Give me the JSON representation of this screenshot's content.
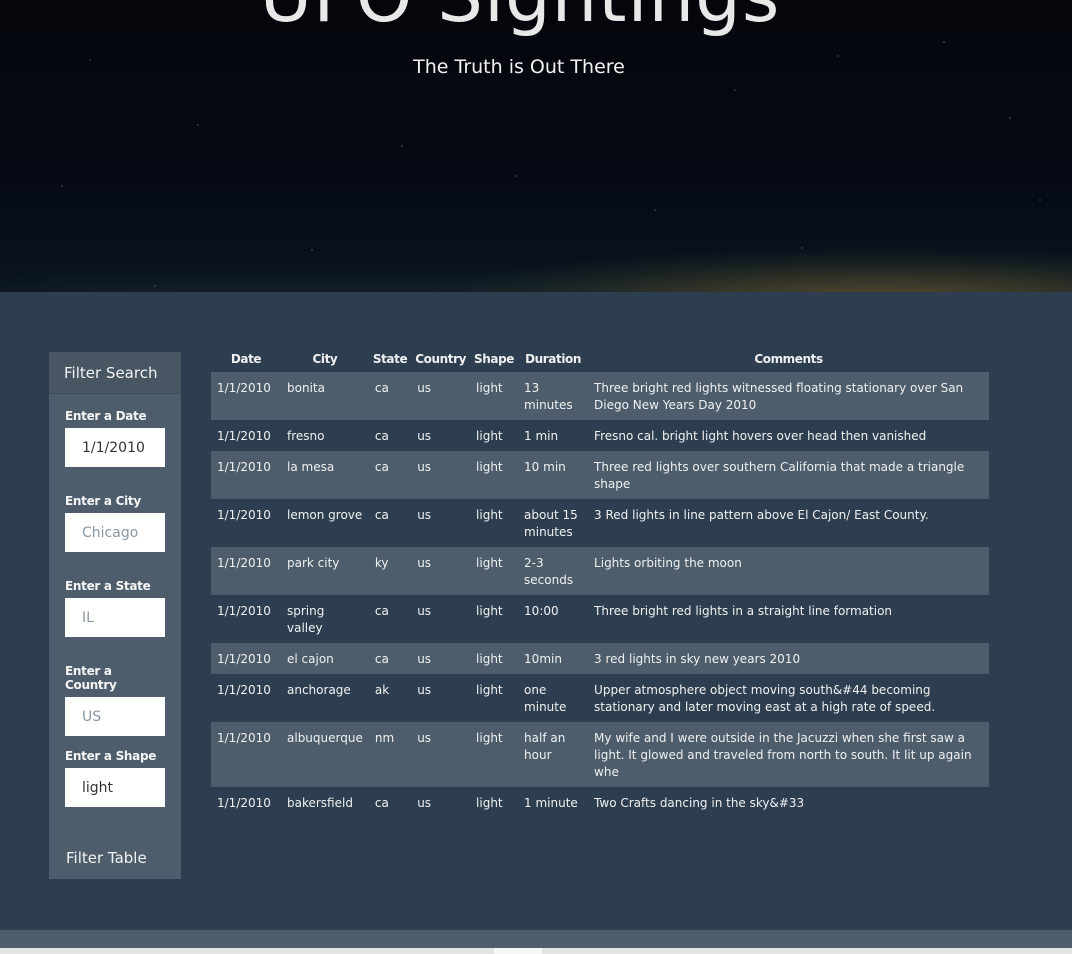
{
  "header": {
    "title": "UFO Sightings",
    "subtitle": "The Truth is Out There"
  },
  "sidebar": {
    "title": "Filter Search",
    "filters": [
      {
        "label": "Enter a Date",
        "value": "1/1/2010",
        "placeholder": ""
      },
      {
        "label": "Enter a City",
        "value": "",
        "placeholder": "Chicago"
      },
      {
        "label": "Enter a State",
        "value": "",
        "placeholder": "IL"
      },
      {
        "label": "Enter a Country",
        "value": "",
        "placeholder": "US"
      },
      {
        "label": "Enter a Shape",
        "value": "light",
        "placeholder": ""
      }
    ],
    "button_label": "Filter Table"
  },
  "table": {
    "columns": [
      "Date",
      "City",
      "State",
      "Country",
      "Shape",
      "Duration",
      "Comments"
    ],
    "rows": [
      [
        "1/1/2010",
        "bonita",
        "ca",
        "us",
        "light",
        "13 minutes",
        "Three bright red lights witnessed floating stationary over San Diego New Years Day 2010"
      ],
      [
        "1/1/2010",
        "fresno",
        "ca",
        "us",
        "light",
        "1 min",
        "Fresno cal. bright light hovers over head then vanished"
      ],
      [
        "1/1/2010",
        "la mesa",
        "ca",
        "us",
        "light",
        "10 min",
        "Three red lights over southern California that made a triangle shape"
      ],
      [
        "1/1/2010",
        "lemon grove",
        "ca",
        "us",
        "light",
        "about 15 minutes",
        "3 Red lights in line pattern above El Cajon/ East County."
      ],
      [
        "1/1/2010",
        "park city",
        "ky",
        "us",
        "light",
        "2-3 seconds",
        "Lights orbiting the moon"
      ],
      [
        "1/1/2010",
        "spring valley",
        "ca",
        "us",
        "light",
        "10:00",
        "Three bright red lights in a straight line formation"
      ],
      [
        "1/1/2010",
        "el cajon",
        "ca",
        "us",
        "light",
        "10min",
        "3 red lights in sky new years 2010"
      ],
      [
        "1/1/2010",
        "anchorage",
        "ak",
        "us",
        "light",
        "one minute",
        "Upper atmosphere object moving south&#44 becoming stationary and later moving east at a high rate of speed."
      ],
      [
        "1/1/2010",
        "albuquerque",
        "nm",
        "us",
        "light",
        "half an hour",
        "My wife and I were outside in the Jacuzzi when she first saw a light. It glowed and traveled from north to south. It lit up again whe"
      ],
      [
        "1/1/2010",
        "bakersfield",
        "ca",
        "us",
        "light",
        "1 minute",
        "Two Crafts dancing in the sky&#33"
      ]
    ]
  }
}
